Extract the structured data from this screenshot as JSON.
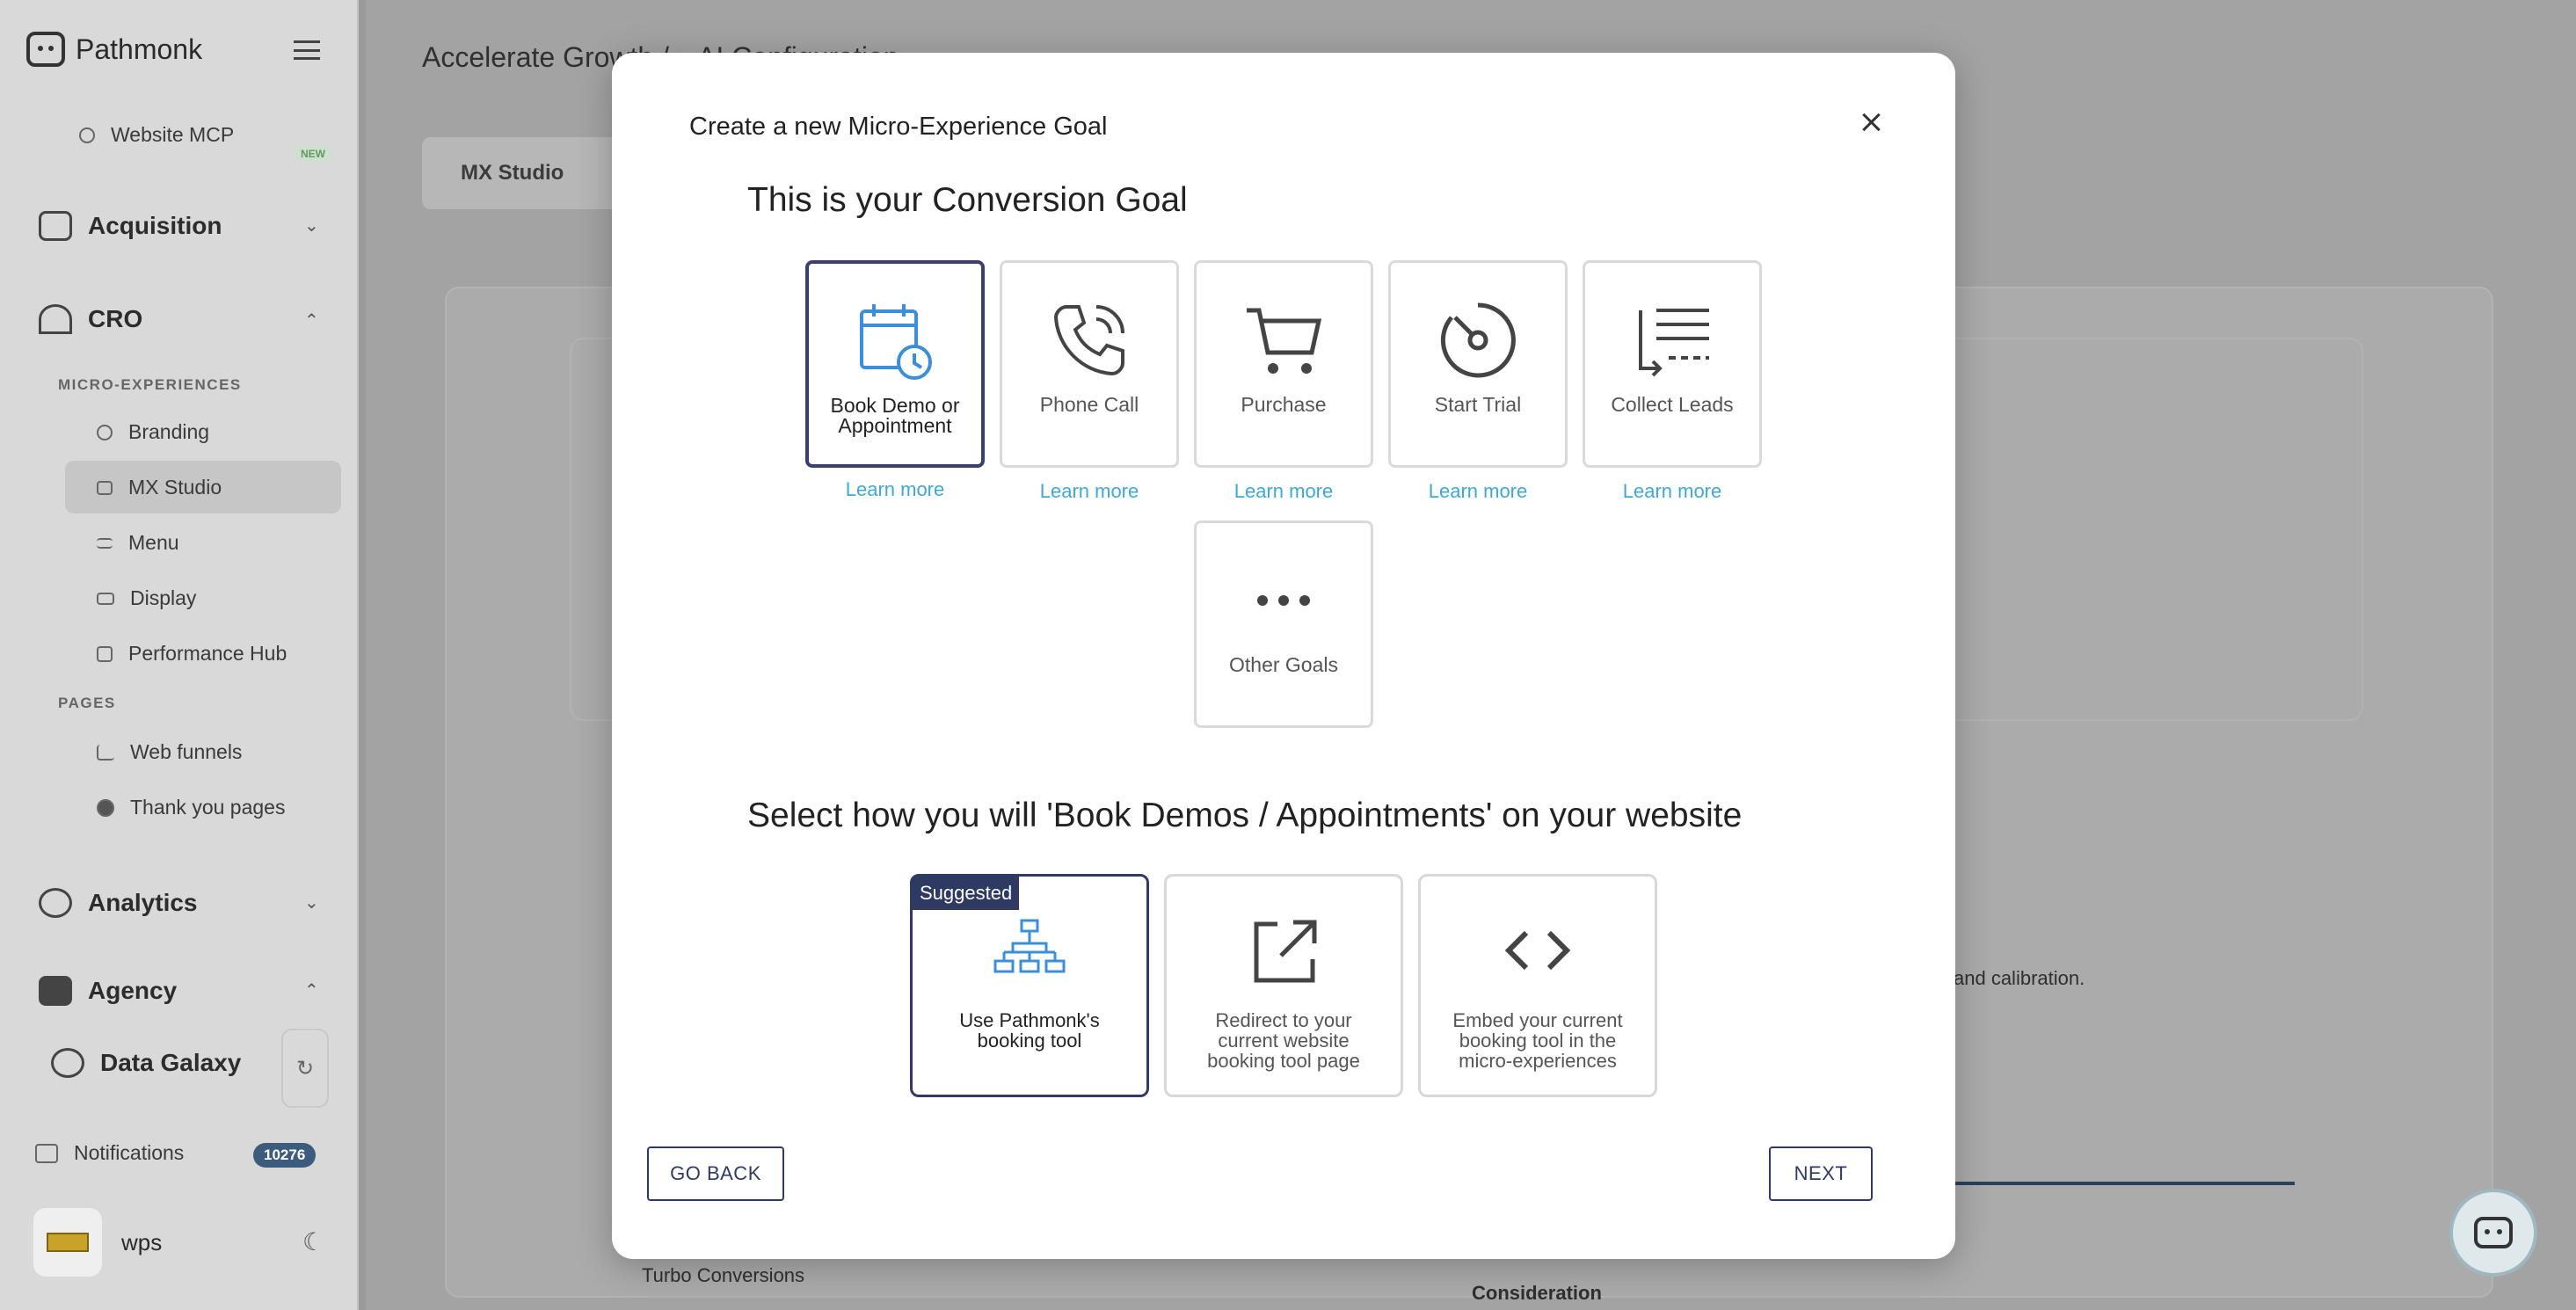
{
  "app": {
    "name": "Pathmonk",
    "breadcrumb": "Accelerate Growth  /  ▸ AI Configuration"
  },
  "sidebar": {
    "website_mcp": "Website MCP",
    "new_badge": "NEW",
    "acquisition": "Acquisition",
    "cro": "CRO",
    "section_micro": "MICRO-EXPERIENCES",
    "items_micro": [
      "Branding",
      "MX Studio",
      "Menu",
      "Display",
      "Performance Hub"
    ],
    "section_pages": "PAGES",
    "items_pages": [
      "Web funnels",
      "Thank you pages"
    ],
    "analytics": "Analytics",
    "agency": "Agency",
    "data_galaxy": "Data Galaxy",
    "notifications": "Notifications",
    "notifications_count": "10276",
    "user": "wps"
  },
  "background": {
    "tab_mx_studio": "MX Studio",
    "partial_text": "and calibration.",
    "select_value": "Turbo Conversions",
    "stage_label": "Consideration"
  },
  "modal": {
    "title": "Create a new Micro-Experience Goal",
    "goal_heading": "This is your Conversion Goal",
    "goals": [
      {
        "label": "Book Demo or Appointment",
        "icon": "calendar-clock-icon",
        "selected": true
      },
      {
        "label": "Phone Call",
        "icon": "phone-icon",
        "selected": false
      },
      {
        "label": "Purchase",
        "icon": "cart-icon",
        "selected": false
      },
      {
        "label": "Start Trial",
        "icon": "dial-icon",
        "selected": false
      },
      {
        "label": "Collect Leads",
        "icon": "list-arrow-icon",
        "selected": false
      },
      {
        "label": "Other Goals",
        "icon": "dots-icon",
        "selected": false
      }
    ],
    "learn_more": "Learn more",
    "method_heading": "Select how you will 'Book Demos / Appointments' on your website",
    "suggested_badge": "Suggested",
    "methods": [
      {
        "label": "Use Pathmonk's booking tool",
        "icon": "sitemap-icon",
        "selected": true
      },
      {
        "label": "Redirect to your current website booking tool page",
        "icon": "external-link-icon",
        "selected": false
      },
      {
        "label": "Embed your current booking tool in the micro-experiences",
        "icon": "code-icon",
        "selected": false
      }
    ],
    "go_back": "GO BACK",
    "next": "NEXT"
  },
  "colors": {
    "accent_dark": "#2f3a63",
    "link": "#3fa9d6",
    "icon_blue": "#3b8fd9"
  }
}
